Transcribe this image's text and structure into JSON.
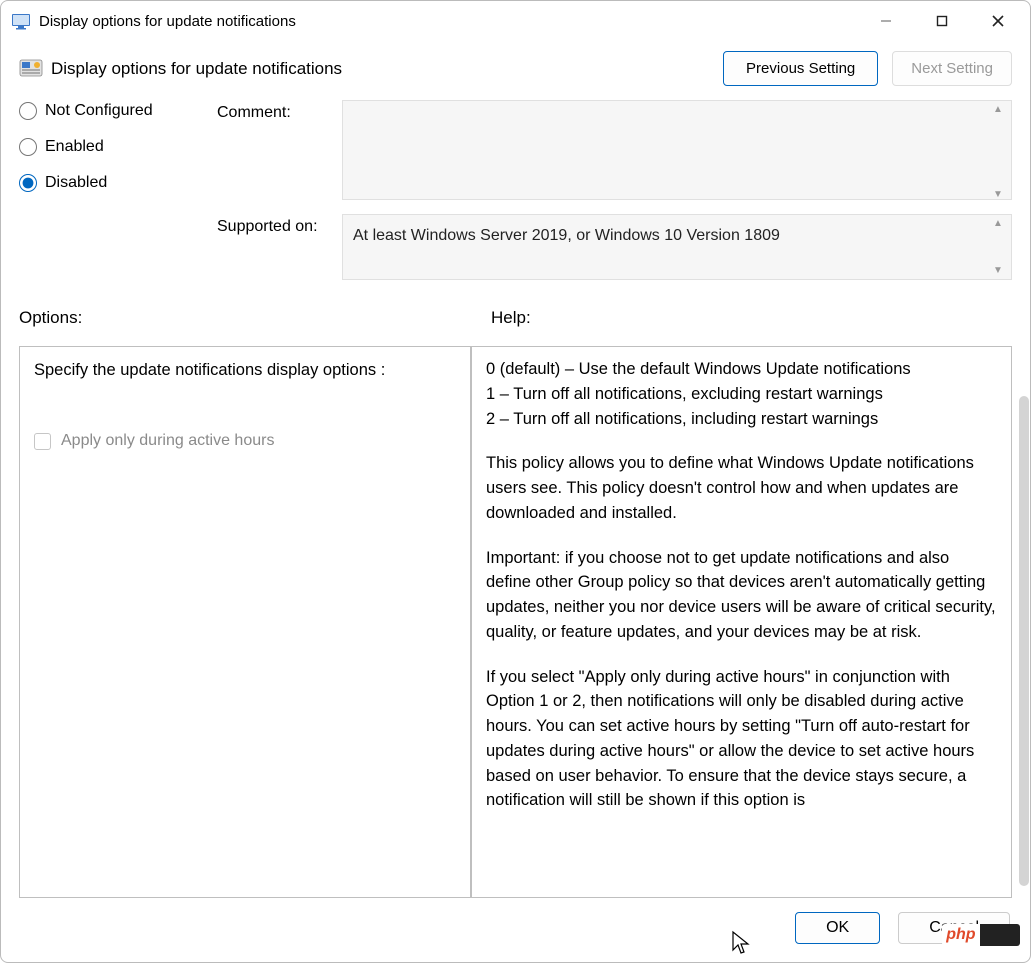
{
  "window": {
    "title": "Display options for update notifications"
  },
  "header": {
    "subtitle": "Display options for update notifications",
    "prev_button": "Previous Setting",
    "next_button": "Next Setting"
  },
  "state": {
    "options": {
      "not_configured": "Not Configured",
      "enabled": "Enabled",
      "disabled": "Disabled"
    },
    "selected": "disabled"
  },
  "meta": {
    "comment_label": "Comment:",
    "comment_value": "",
    "supported_label": "Supported on:",
    "supported_value": "At least Windows Server 2019, or Windows 10 Version 1809"
  },
  "sections": {
    "options_label": "Options:",
    "help_label": "Help:"
  },
  "options_panel": {
    "specify_label": "Specify the update notifications display options :",
    "apply_active_hours_label": "Apply only during active hours",
    "apply_active_hours_checked": false
  },
  "help_panel": {
    "lines": {
      "l0": "0 (default) – Use the default Windows Update notifications",
      "l1": "1 – Turn off all notifications, excluding restart warnings",
      "l2": "2 – Turn off all notifications, including restart warnings"
    },
    "p1": "This policy allows you to define what Windows Update notifications users see. This policy doesn't control how and when updates are downloaded and installed.",
    "p2": "Important: if you choose not to get update notifications and also define other Group policy so that devices aren't automatically getting updates, neither you nor device users will be aware of critical security, quality, or feature updates, and your devices may be at risk.",
    "p3": "If you select \"Apply only during active hours\" in conjunction with Option 1 or 2, then notifications will only be disabled during active hours. You can set active hours by setting \"Turn off auto-restart for updates during active hours\" or allow the device to set active hours based on user behavior. To ensure that the device stays secure, a notification will still be shown if this option is"
  },
  "footer": {
    "ok": "OK",
    "cancel": "Cancel"
  },
  "badge": {
    "php": "php"
  }
}
